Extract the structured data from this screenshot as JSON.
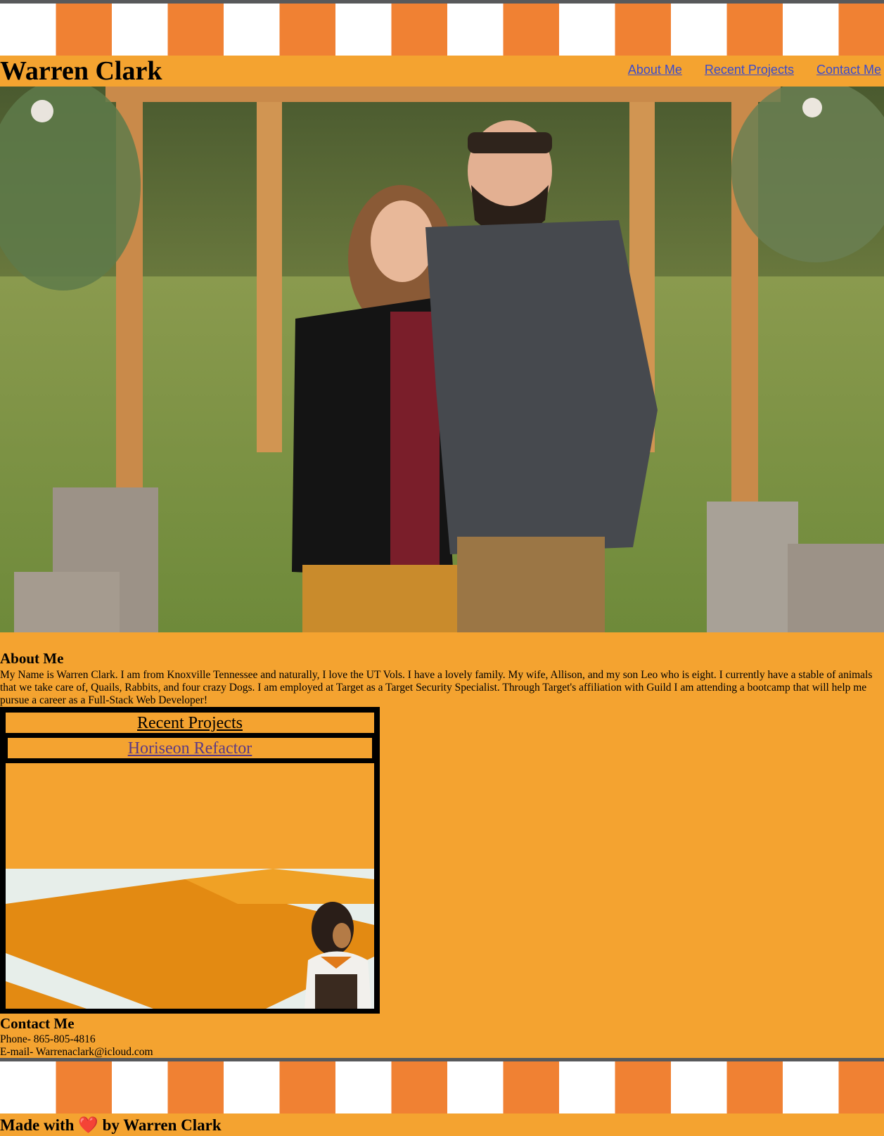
{
  "header": {
    "title": "Warren Clark",
    "nav": [
      "About Me",
      "Recent Projects",
      "Contact Me"
    ]
  },
  "hero": {
    "image": "couple-photo"
  },
  "about": {
    "title": "About Me",
    "text": "My Name is Warren Clark. I am from Knoxville Tennessee and naturally, I love the UT Vols. I have a lovely family. My wife, Allison, and my son Leo who is eight. I currently have a stable of animals that we take care of, Quails, Rabbits, and four crazy Dogs. I am employed at Target as a Target Security Specialist. Through Target's affiliation with Guild I am attending a bootcamp that will help me pursue a career as a Full-Stack Web Developer!"
  },
  "projects": {
    "title": "Recent Projects",
    "items": [
      {
        "label": "Horiseon Refactor",
        "image": "checkerboard-dog-photo"
      }
    ]
  },
  "contact": {
    "title": "Contact Me",
    "phone": "Phone- 865-805-4816",
    "email": "E-mail- Warrenaclark@icloud.com"
  },
  "footer": {
    "prefix": "Made with",
    "heart": "❤️",
    "suffix": "by Warren Clark"
  },
  "colors": {
    "page_bg": "#f4a330",
    "stripe_orange": "#f08133",
    "stripe_white": "#ffffff",
    "stripe_border": "#58595b",
    "nav_link": "#3b4bcc",
    "visited_link": "#5b3a86"
  }
}
